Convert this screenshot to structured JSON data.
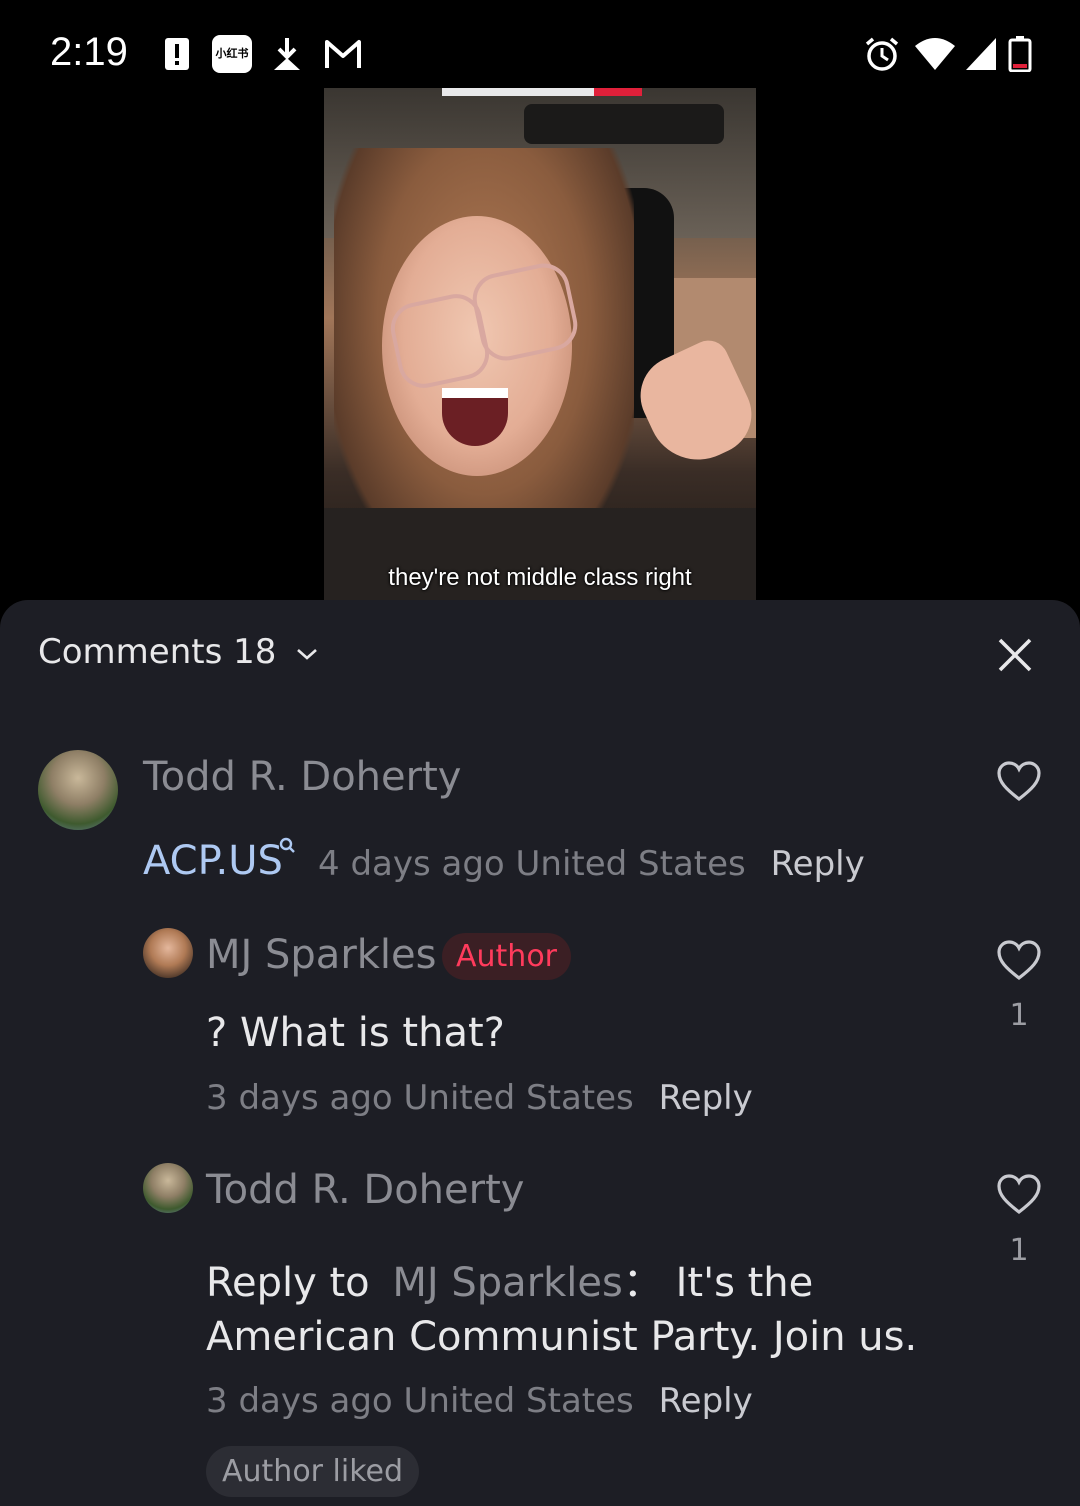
{
  "status_bar": {
    "time": "2:19",
    "left_icons": [
      "alert-icon",
      "xiaohongshu-app-icon",
      "download-icon",
      "gmail-icon"
    ],
    "right_icons": [
      "alarm-icon",
      "wifi-icon",
      "signal-icon",
      "battery-icon"
    ],
    "app_badge_text": "小红书"
  },
  "video": {
    "caption": "they're not middle class right"
  },
  "comments_panel": {
    "title": "Comments 18",
    "comments": [
      {
        "username": "Todd R. Doherty",
        "text_link": "ACP.US",
        "time": "4 days ago",
        "location": "United States",
        "reply_label": "Reply"
      },
      {
        "username": "MJ Sparkles",
        "badge": "Author",
        "text": "? What is that?",
        "time": "3 days ago",
        "location": "United States",
        "reply_label": "Reply",
        "likes": "1"
      },
      {
        "username": "Todd R. Doherty",
        "reply_prefix": "Reply to",
        "reply_target": "MJ Sparkles",
        "separator": "：",
        "text_line1": "It's the",
        "text_line2": "American Communist Party. Join us.",
        "time": "3 days ago",
        "location": "United States",
        "reply_label": "Reply",
        "likes": "1",
        "author_liked": "Author liked"
      }
    ]
  }
}
